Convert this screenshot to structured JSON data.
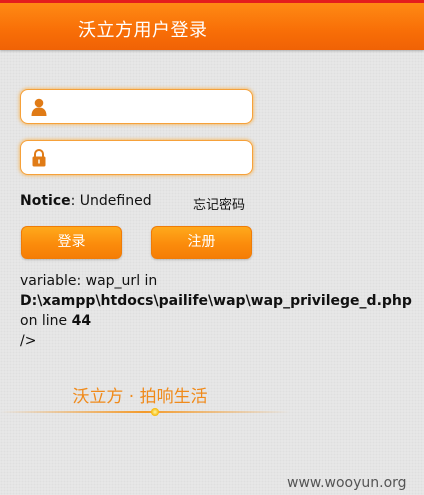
{
  "header": {
    "title": "沃立方用户登录"
  },
  "form": {
    "username": {
      "value": "",
      "icon": "user-icon"
    },
    "password": {
      "value": "",
      "icon": "lock-icon"
    },
    "notice_label": "Notice",
    "notice_text": ": Undefined",
    "forgot_label": "忘记密码",
    "login_label": "登录",
    "register_label": "注册"
  },
  "error": {
    "line1": "variable: wap_url in",
    "path": "D:\\xampp\\htdocs\\pailife\\wap\\wap_privilege_d.php",
    "on_line_text": "on line ",
    "line_number": "44",
    "closing": "/>"
  },
  "footer": {
    "slogan": "沃立方 · 拍响生活"
  },
  "watermark": "www.wooyun.org",
  "colors": {
    "accent": "#f8780a",
    "header_top": "#e41d1d",
    "input_border": "#f6a13a"
  }
}
